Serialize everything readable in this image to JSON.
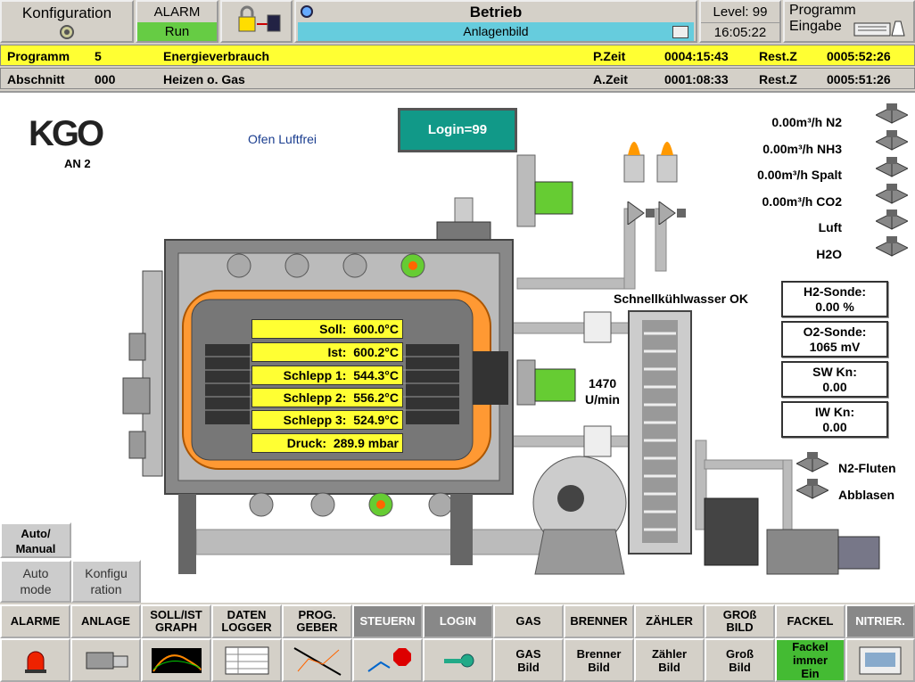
{
  "header": {
    "config_label": "Konfiguration",
    "alarm_label": "ALARM",
    "run_label": "Run",
    "mode_title": "Betrieb",
    "screen_name": "Anlagenbild",
    "level": "Level: 99",
    "time": "16:05:22",
    "program_entry_line1": "Programm",
    "program_entry_line2": "Eingabe"
  },
  "program_bar": {
    "label": "Programm",
    "number": "5",
    "name": "Energieverbrauch",
    "ptime_label": "P.Zeit",
    "ptime": "0004:15:43",
    "rest_label": "Rest.Z",
    "rest": "0005:52:26"
  },
  "section_bar": {
    "label": "Abschnitt",
    "number": "000",
    "name": "Heizen o. Gas",
    "atime_label": "A.Zeit",
    "atime": "0001:08:33",
    "rest_label": "Rest.Z",
    "rest": "0005:51:26"
  },
  "plant": {
    "logo": "KGO",
    "unit": "AN 2",
    "status": "Ofen Luftfrei",
    "login": "Login=99",
    "quench_status": "Schnellkühlwasser OK",
    "rpm_value": "1470",
    "rpm_unit": "U/min",
    "readings": [
      {
        "label": "Soll:",
        "value": "600.0°C"
      },
      {
        "label": "Ist:",
        "value": "600.2°C"
      },
      {
        "label": "Schlepp 1:",
        "value": "544.3°C"
      },
      {
        "label": "Schlepp 2:",
        "value": "556.2°C"
      },
      {
        "label": "Schlepp 3:",
        "value": "524.9°C"
      },
      {
        "label": "Druck:",
        "value": "289.9 mbar"
      }
    ],
    "gases": [
      "0.00m³/h N2",
      "0.00m³/h NH3",
      "0.00m³/h Spalt",
      "0.00m³/h CO2",
      "Luft",
      "H2O"
    ],
    "sensors": [
      {
        "label": "H2-Sonde:",
        "value": "0.00 %"
      },
      {
        "label": "O2-Sonde:",
        "value": "1065 mV"
      },
      {
        "label": "SW Kn:",
        "value": "0.00"
      },
      {
        "label": "IW Kn:",
        "value": "0.00"
      }
    ],
    "n2_flood": "N2-Fluten",
    "blowoff": "Abblasen"
  },
  "side_buttons": {
    "auto_manual": "Auto/ Manual",
    "auto_mode": "Auto mode",
    "config": "Konfigu ration"
  },
  "nav_top": [
    "ALARME",
    "ANLAGE",
    "SOLL/IST GRAPH",
    "DATEN LOGGER",
    "PROG. GEBER",
    "STEUERN",
    "LOGIN",
    "GAS",
    "BRENNER",
    "ZÄHLER",
    "GROß BILD",
    "FACKEL",
    "NITRIER."
  ],
  "nav_bottom": {
    "gas": "GAS Bild",
    "brenner": "Brenner Bild",
    "zaehler": "Zähler Bild",
    "gross": "Groß Bild",
    "fackel": "Fackel immer Ein"
  },
  "colors": {
    "accent_yellow": "#ffff33",
    "run_green": "#66cc44",
    "screen_cyan": "#66ccdd",
    "login_teal": "#119988",
    "motor_green": "#66cc33",
    "furnace_orange": "#ff9933"
  }
}
